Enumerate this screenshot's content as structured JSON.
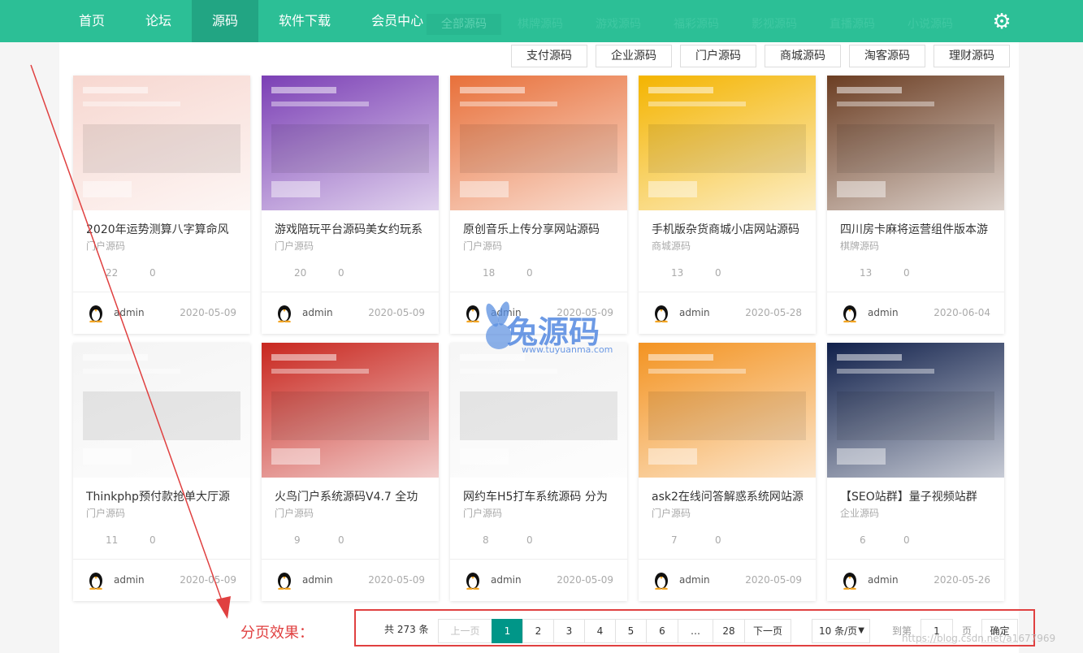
{
  "nav": {
    "items": [
      "首页",
      "论坛",
      "源码",
      "软件下载",
      "会员中心"
    ],
    "active_index": 2
  },
  "subnav": {
    "items": [
      "全部源码",
      "棋牌源码",
      "游戏源码",
      "福彩源码",
      "影视源码",
      "直播源码",
      "小说源码"
    ]
  },
  "filters": [
    "支付源码",
    "企业源码",
    "门户源码",
    "商城源码",
    "淘客源码",
    "理财源码"
  ],
  "cards": [
    {
      "title": "2020年运势测算八字算命风",
      "category": "门户源码",
      "views": "22",
      "comments": "0",
      "user": "admin",
      "date": "2020-05-09"
    },
    {
      "title": "游戏陪玩平台源码美女约玩系",
      "category": "门户源码",
      "views": "20",
      "comments": "0",
      "user": "admin",
      "date": "2020-05-09"
    },
    {
      "title": "原创音乐上传分享网站源码",
      "category": "门户源码",
      "views": "18",
      "comments": "0",
      "user": "admin",
      "date": "2020-05-09"
    },
    {
      "title": "手机版杂货商城小店网站源码",
      "category": "商城源码",
      "views": "13",
      "comments": "0",
      "user": "admin",
      "date": "2020-05-28"
    },
    {
      "title": "四川房卡麻将运营组件版本游",
      "category": "棋牌源码",
      "views": "13",
      "comments": "0",
      "user": "admin",
      "date": "2020-06-04"
    },
    {
      "title": "Thinkphp预付款抢单大厅源",
      "category": "门户源码",
      "views": "11",
      "comments": "0",
      "user": "admin",
      "date": "2020-05-09"
    },
    {
      "title": "火鸟门户系统源码V4.7 全功",
      "category": "门户源码",
      "views": "9",
      "comments": "0",
      "user": "admin",
      "date": "2020-05-09"
    },
    {
      "title": "网约车H5打车系统源码 分为",
      "category": "门户源码",
      "views": "8",
      "comments": "0",
      "user": "admin",
      "date": "2020-05-09"
    },
    {
      "title": "ask2在线问答解惑系统网站源",
      "category": "门户源码",
      "views": "7",
      "comments": "0",
      "user": "admin",
      "date": "2020-05-09"
    },
    {
      "title": "【SEO站群】量子视频站群",
      "category": "企业源码",
      "views": "6",
      "comments": "0",
      "user": "admin",
      "date": "2020-05-26"
    }
  ],
  "pagination": {
    "total": "共 273 条",
    "prev": "上一页",
    "pages": [
      "1",
      "2",
      "3",
      "4",
      "5",
      "6",
      "…",
      "28"
    ],
    "current": "1",
    "next": "下一页",
    "page_size": "10 条/页",
    "goto_label": "到第",
    "goto_value": "1",
    "page_unit": "页",
    "confirm": "确定"
  },
  "annotation": "分页效果：",
  "watermark_logo": "兔源码",
  "watermark_url": "www.tuyuanma.com",
  "watermark_blog": "https://blog.csdn.net/a1677969",
  "thumb_colors": [
    "#f7d7d0",
    "#7b3fb5",
    "#e8703a",
    "#f4b400",
    "#6b3d22",
    "#f4f4f4",
    "#c8261e",
    "#f6f6f6",
    "#f39321",
    "#0f1f4a"
  ]
}
